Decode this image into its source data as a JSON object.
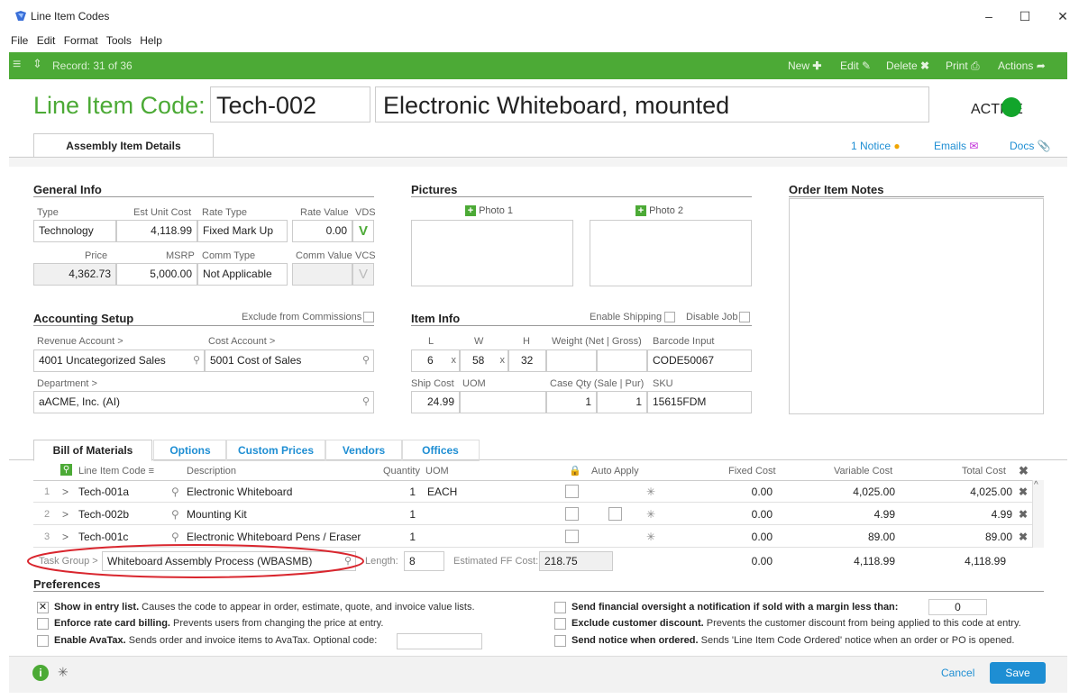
{
  "window": {
    "title": "Line Item Codes"
  },
  "menu": [
    "File",
    "Edit",
    "Format",
    "Tools",
    "Help"
  ],
  "toolbar": {
    "record": "Record: 31 of 36",
    "new": "New",
    "edit": "Edit",
    "delete": "Delete",
    "print": "Print",
    "actions": "Actions"
  },
  "header": {
    "label": "Line Item Code:",
    "code": "Tech-002",
    "description": "Electronic Whiteboard, mounted",
    "status": "ACTIVE"
  },
  "tabs": {
    "main": "Assembly Item Details",
    "notice": "1 Notice",
    "emails": "Emails",
    "docs": "Docs"
  },
  "general": {
    "title": "General Info",
    "type_lbl": "Type",
    "type": "Technology",
    "euc_lbl": "Est Unit Cost",
    "euc": "4,118.99",
    "rate_type_lbl": "Rate Type",
    "rate_type": "Fixed Mark Up",
    "rate_value_lbl": "Rate Value",
    "rate_value": "0.00",
    "vds_lbl": "VDS",
    "vds": "V",
    "price_lbl": "Price",
    "price": "4,362.73",
    "msrp_lbl": "MSRP",
    "msrp": "5,000.00",
    "comm_type_lbl": "Comm Type",
    "comm_type": "Not Applicable",
    "comm_value_lbl": "Comm Value",
    "vcs_lbl": "VCS",
    "vcs": "V"
  },
  "pictures": {
    "title": "Pictures",
    "photo1": "Photo 1",
    "photo2": "Photo 2"
  },
  "notes": {
    "title": "Order Item Notes"
  },
  "accounting": {
    "title": "Accounting Setup",
    "exclude": "Exclude from Commissions",
    "rev_lbl": "Revenue Account >",
    "rev": "4001 Uncategorized Sales",
    "cost_lbl": "Cost Account >",
    "cost": "5001 Cost of Sales",
    "dept_lbl": "Department >",
    "dept": "aACME, Inc. (AI)"
  },
  "item": {
    "title": "Item Info",
    "enable_ship": "Enable Shipping",
    "disable_job": "Disable Job",
    "l_lbl": "L",
    "w_lbl": "W",
    "h_lbl": "H",
    "l": "6",
    "w": "58",
    "h": "32",
    "x": "x",
    "weight_lbl": "Weight (Net | Gross)",
    "barcode_lbl": "Barcode Input",
    "barcode": "CODE50067",
    "ship_lbl": "Ship Cost",
    "uom_lbl": "UOM",
    "ship": "24.99",
    "case_lbl": "Case Qty (Sale | Pur)",
    "case_sale": "1",
    "case_pur": "1",
    "sku_lbl": "SKU",
    "sku": "15615FDM"
  },
  "bom": {
    "tabs": [
      "Bill of Materials",
      "Options",
      "Custom Prices",
      "Vendors",
      "Offices"
    ],
    "headers": {
      "code": "Line Item Code",
      "desc": "Description",
      "qty": "Quantity",
      "uom": "UOM",
      "auto": "Auto Apply",
      "fixed": "Fixed Cost",
      "var": "Variable Cost",
      "total": "Total Cost"
    },
    "rows": [
      {
        "n": "1",
        "code": "Tech-001a",
        "desc": "Electronic Whiteboard",
        "qty": "1",
        "uom": "EACH",
        "fixed": "0.00",
        "var": "4,025.00",
        "total": "4,025.00"
      },
      {
        "n": "2",
        "code": "Tech-002b",
        "desc": "Mounting Kit",
        "qty": "1",
        "uom": "",
        "fixed": "0.00",
        "var": "4.99",
        "total": "4.99"
      },
      {
        "n": "3",
        "code": "Tech-001c",
        "desc": "Electronic Whiteboard Pens / Eraser",
        "qty": "1",
        "uom": "",
        "fixed": "0.00",
        "var": "89.00",
        "total": "89.00"
      }
    ],
    "task_lbl": "Task Group >",
    "task": "Whiteboard Assembly Process  (WBASMB)",
    "length_lbl": "Length:",
    "length": "8",
    "ff_lbl": "Estimated FF Cost:",
    "ff": "218.75",
    "sum_fixed": "0.00",
    "sum_var": "4,118.99",
    "sum_total": "4,118.99"
  },
  "prefs": {
    "title": "Preferences",
    "p1b": "Show in entry list.",
    "p1": " Causes the code to appear in order, estimate, quote, and invoice value lists.",
    "p2b": "Enforce rate card billing.",
    "p2": " Prevents users from changing the price at entry.",
    "p3b": "Enable AvaTax.",
    "p3": " Sends order and invoice items to AvaTax. Optional code:",
    "p4b": "Send financial oversight a notification if sold with a margin less than:",
    "p4v": "0",
    "p5b": "Exclude customer discount.",
    "p5": " Prevents the customer discount from being applied to this code at entry.",
    "p6b": "Send notice when ordered.",
    "p6": " Sends 'Line Item Code Ordered' notice when an order or PO is opened."
  },
  "footer": {
    "cancel": "Cancel",
    "save": "Save"
  }
}
